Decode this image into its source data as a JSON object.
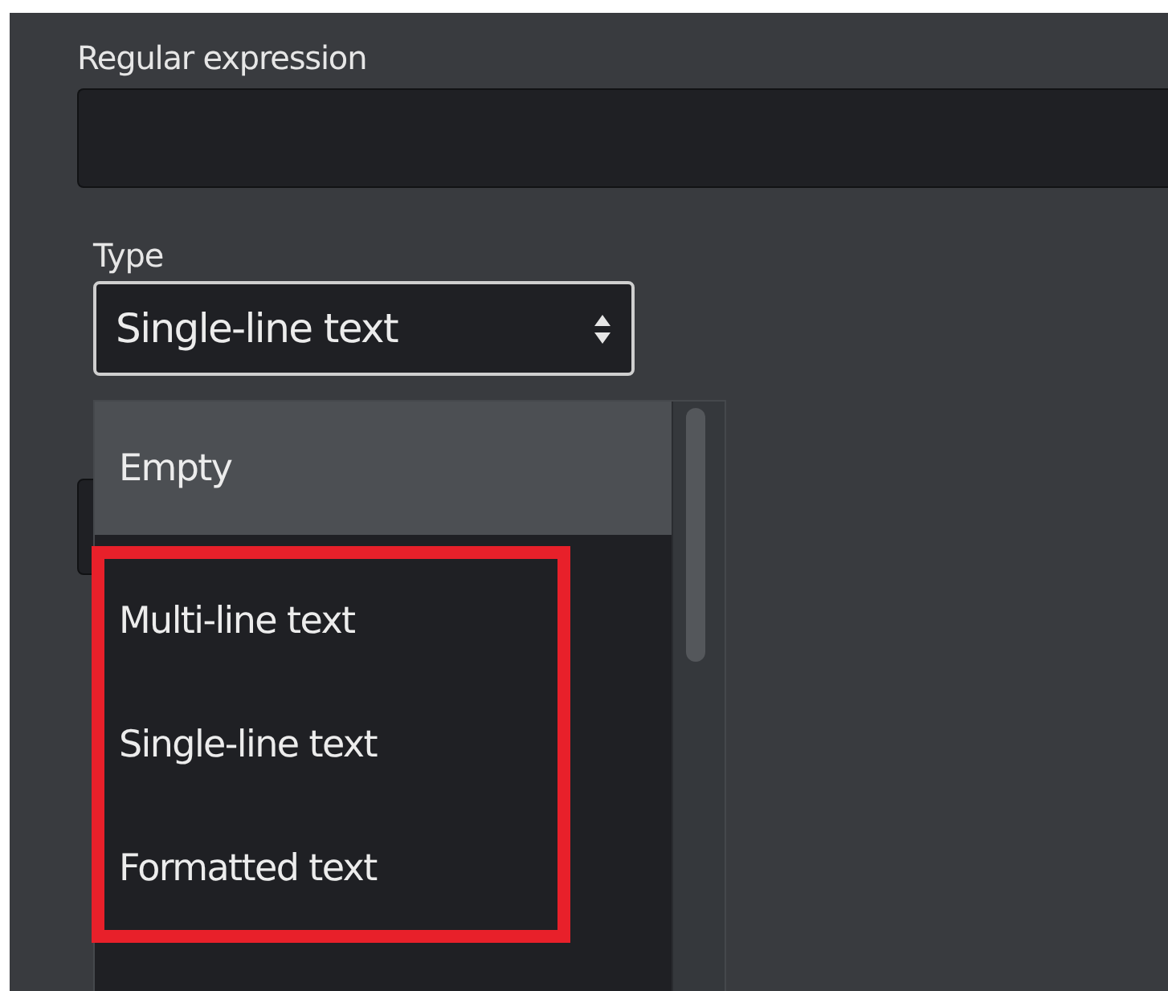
{
  "regex_field": {
    "label": "Regular expression"
  },
  "type_field": {
    "label": "Type",
    "value": "Single-line text"
  },
  "dropdown": {
    "options": [
      {
        "label": "Empty",
        "selected": true,
        "highlighted": false
      },
      {
        "label": "Multi-line text",
        "selected": false,
        "highlighted": true
      },
      {
        "label": "Single-line text",
        "selected": false,
        "highlighted": true
      },
      {
        "label": "Formatted text",
        "selected": false,
        "highlighted": true
      }
    ]
  }
}
